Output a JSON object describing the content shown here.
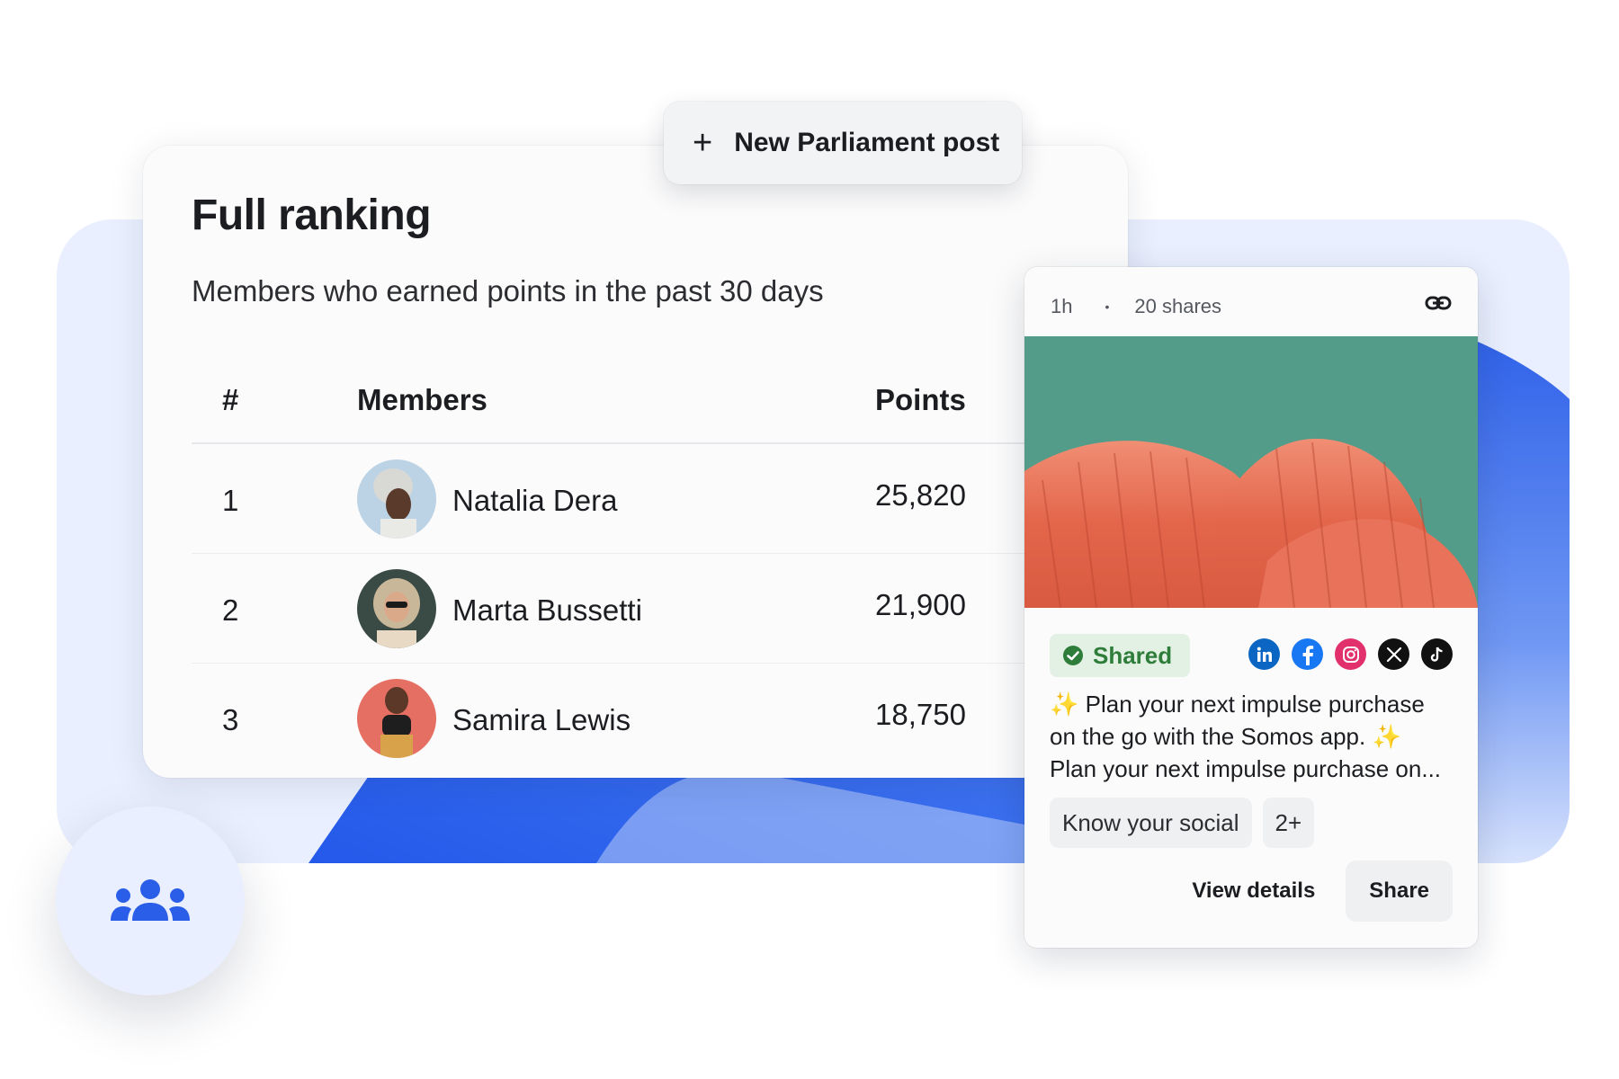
{
  "new_post_button": {
    "icon": "plus-icon",
    "label": "New Parliament post"
  },
  "ranking": {
    "title": "Full ranking",
    "subtitle": "Members who earned points in the past 30 days",
    "columns": {
      "rank": "#",
      "members": "Members",
      "points": "Points"
    },
    "rows": [
      {
        "rank": "1",
        "name": "Natalia Dera",
        "points": "25,820"
      },
      {
        "rank": "2",
        "name": "Marta Bussetti",
        "points": "21,900"
      },
      {
        "rank": "3",
        "name": "Samira Lewis",
        "points": "18,750"
      }
    ]
  },
  "post": {
    "time": "1h",
    "separator": "•",
    "shares": "20 shares",
    "status": "Shared",
    "social": [
      "linkedin-icon",
      "facebook-icon",
      "instagram-icon",
      "x-icon",
      "tiktok-icon"
    ],
    "text_line1": "Plan your next impulse purchase on the go with the Somos app.",
    "text_line2": "Plan your next impulse purchase on...",
    "tags": [
      "Know your social",
      "2+"
    ],
    "view_details": "View details",
    "share": "Share"
  },
  "colors": {
    "accent": "#2b5ee8",
    "panel": "#e9effe",
    "shared_green": "#2e7d3a"
  }
}
